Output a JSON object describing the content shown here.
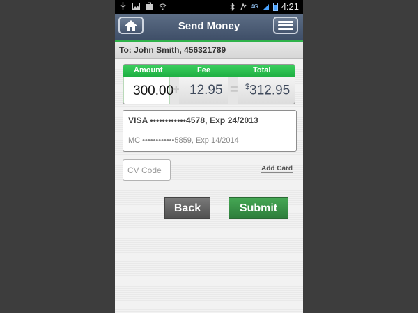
{
  "status_bar": {
    "time": "4:21",
    "network": "4G",
    "left_icons": [
      "usb-icon",
      "image-icon",
      "briefcase-icon",
      "wifi-icon"
    ],
    "right_icons": [
      "bluetooth-icon",
      "vibrate-icon",
      "signal-icon",
      "battery-icon"
    ]
  },
  "header": {
    "title": "Send Money",
    "home_icon": "home-icon",
    "menu_icon": "menu-icon",
    "colors": {
      "header": "#4a5a73",
      "accent": "#2fb24a"
    }
  },
  "recipient": {
    "label": "To: John Smith, 456321789"
  },
  "amounts": {
    "amount_label": "Amount",
    "fee_label": "Fee",
    "total_label": "Total",
    "amount_value": "300.00",
    "fee_value": "12.95",
    "total_currency": "$",
    "total_value": "312.95",
    "plus_symbol": "+",
    "equals_symbol": "="
  },
  "cards": {
    "primary": "VISA ••••••••••••4578, Exp 24/2013",
    "secondary": "MC ••••••••••••5859, Exp 14/2014"
  },
  "cv_code": {
    "placeholder": "CV Code"
  },
  "add_card_label": "Add Card",
  "buttons": {
    "back": "Back",
    "submit": "Submit"
  }
}
